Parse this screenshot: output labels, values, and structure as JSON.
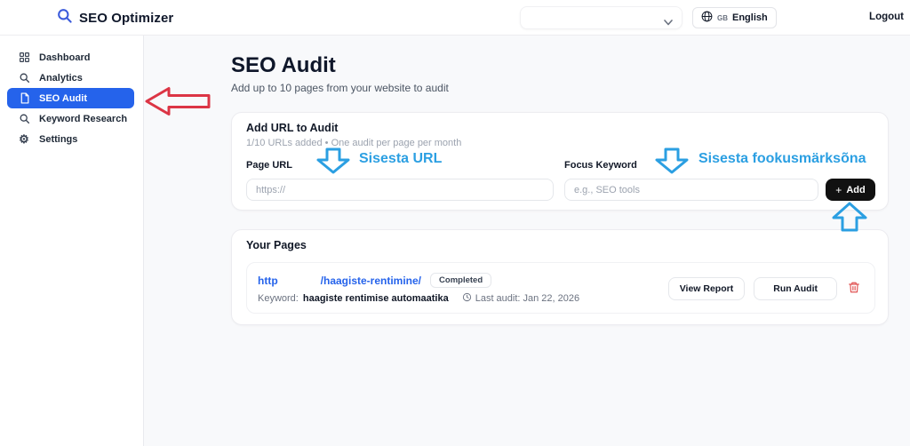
{
  "header": {
    "app_title": "SEO Optimizer",
    "language_code": "GB",
    "language_label": "English",
    "logout_label": "Logout"
  },
  "sidebar": {
    "items": [
      {
        "label": "Dashboard"
      },
      {
        "label": "Analytics"
      },
      {
        "label": "SEO Audit"
      },
      {
        "label": "Keyword Research"
      },
      {
        "label": "Settings"
      }
    ]
  },
  "main": {
    "title": "SEO Audit",
    "subtitle": "Add up to 10 pages from your website to audit",
    "add_card": {
      "title": "Add URL to Audit",
      "meta": "1/10 URLs added • One audit per page per month",
      "page_url_label": "Page URL",
      "page_url_placeholder": "https://",
      "page_url_value": "",
      "focus_keyword_label": "Focus Keyword",
      "focus_keyword_placeholder": "e.g., SEO tools",
      "focus_keyword_value": "",
      "add_button_plus": "+",
      "add_button_label": "Add"
    },
    "pages_card": {
      "title": "Your Pages",
      "row": {
        "url_start": "http",
        "url_end": "/haagiste-rentimine/",
        "status": "Completed",
        "keyword_label": "Keyword:",
        "keyword": "haagiste rentimise automaatika",
        "last_audit": "Last audit: Jan 22, 2026",
        "view_report_label": "View Report",
        "run_audit_label": "Run Audit"
      }
    }
  },
  "annotations": {
    "url_hint": "Sisesta URL",
    "keyword_hint": "Sisesta fookusmärksõna"
  },
  "colors": {
    "active_blue": "#2563eb",
    "link_blue": "#2563eb",
    "annotation_blue": "#2b9fe2",
    "arrow_red": "#dc3545",
    "danger_red": "#e05252"
  }
}
